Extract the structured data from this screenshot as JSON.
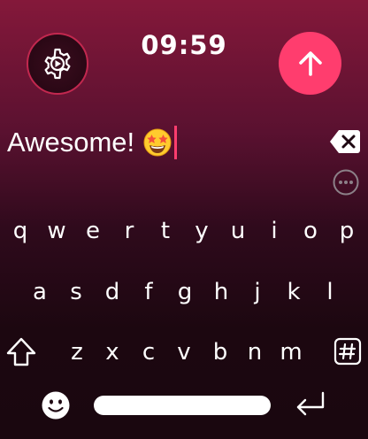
{
  "header": {
    "time": "09:59"
  },
  "input": {
    "value": "Awesome!",
    "emoji": "star-struck"
  },
  "keyboard": {
    "row1": [
      "q",
      "w",
      "e",
      "r",
      "t",
      "y",
      "u",
      "i",
      "o",
      "p"
    ],
    "row2": [
      "a",
      "s",
      "d",
      "f",
      "g",
      "h",
      "j",
      "k",
      "l"
    ],
    "row3": [
      "z",
      "x",
      "c",
      "v",
      "b",
      "n",
      "m"
    ]
  },
  "colors": {
    "accent": "#ff3d6e",
    "background_top": "#84183a",
    "background_bottom": "#1a070f"
  },
  "icons": {
    "settings": "gear-icon",
    "send": "arrow-up-icon",
    "backspace": "backspace-icon",
    "more": "more-dots-icon",
    "shift": "shift-icon",
    "symbols": "hash-icon",
    "emoji": "smiley-icon",
    "return": "return-icon"
  }
}
